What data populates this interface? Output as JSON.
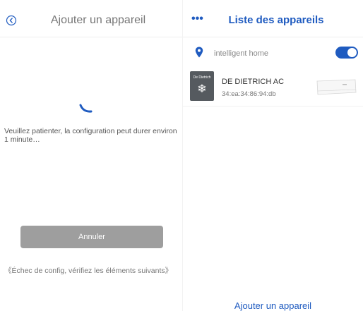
{
  "left_panel": {
    "title": "Ajouter un appareil",
    "wait_message": "Veuillez patienter, la configuration peut durer environ 1 minute…",
    "cancel_label": "Annuler",
    "failure_note": "《Échec de config, vérifiez les éléments suivants》"
  },
  "right_panel": {
    "title": "Liste des appareils",
    "home_name": "intelligent home",
    "home_toggle_on": true,
    "devices": [
      {
        "brand": "De Dietrich",
        "name": "DE DIETRICH AC",
        "mac": "34:ea:34:86:94:db"
      }
    ],
    "add_device_label": "Ajouter un appareil"
  },
  "colors": {
    "accent": "#1f5bc0",
    "button_gray": "#9e9e9e",
    "logo_bg": "#555a5f"
  },
  "icons": [
    "back-circle-icon",
    "loading-spinner-icon",
    "more-dots-icon",
    "location-pin-icon",
    "snowflake-icon",
    "air-conditioner-image"
  ]
}
